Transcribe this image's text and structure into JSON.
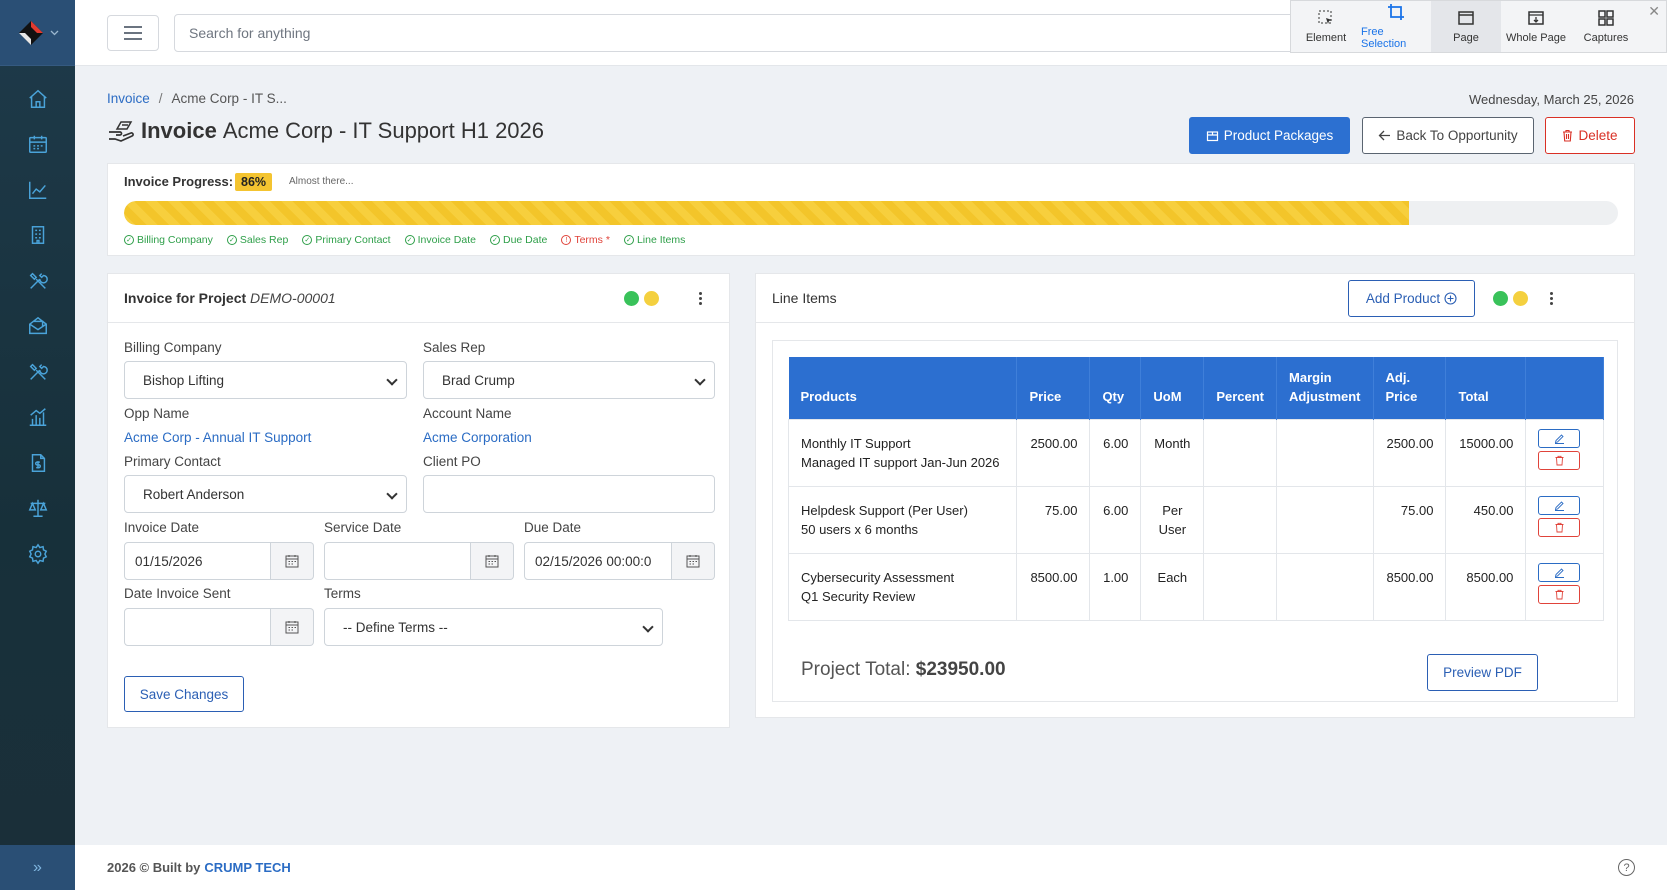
{
  "topbar": {
    "search_placeholder": "Search for anything"
  },
  "capture_toolbar": {
    "items": [
      {
        "label": "Element",
        "icon": "element-select-icon"
      },
      {
        "label": "Free Selection",
        "icon": "crop-icon"
      },
      {
        "label": "Page",
        "icon": "page-icon"
      },
      {
        "label": "Whole Page",
        "icon": "whole-page-icon"
      },
      {
        "label": "Captures",
        "icon": "grid-icon"
      }
    ],
    "active_color": "#1a73e8"
  },
  "sidebar": {
    "items": [
      {
        "icon": "home-icon"
      },
      {
        "icon": "calendar-icon"
      },
      {
        "icon": "chart-line-icon"
      },
      {
        "icon": "building-icon"
      },
      {
        "icon": "tools-icon"
      },
      {
        "icon": "mail-open-icon"
      },
      {
        "icon": "tools-icon"
      },
      {
        "icon": "bar-chart-icon"
      },
      {
        "icon": "invoice-dollar-icon"
      },
      {
        "icon": "scale-icon"
      },
      {
        "icon": "gear-icon"
      }
    ],
    "toggle": "»"
  },
  "breadcrumb": {
    "root": "Invoice",
    "current": "Acme Corp - IT S..."
  },
  "today": "Wednesday, March 25, 2026",
  "page": {
    "title_prefix": "Invoice",
    "title": "Acme Corp - IT Support H1 2026"
  },
  "header_buttons": {
    "packages": "Product Packages",
    "back": "Back To Opportunity",
    "delete": "Delete"
  },
  "progress": {
    "label": "Invoice Progress:",
    "percent_text": "86%",
    "percent": 86,
    "hint": "Almost there...",
    "checks": [
      {
        "label": "Billing Company",
        "done": true
      },
      {
        "label": "Sales Rep",
        "done": true
      },
      {
        "label": "Primary Contact",
        "done": true
      },
      {
        "label": "Invoice Date",
        "done": true
      },
      {
        "label": "Due Date",
        "done": true
      },
      {
        "label": "Terms *",
        "done": false
      },
      {
        "label": "Line Items",
        "done": true
      }
    ]
  },
  "project_card": {
    "title": "Invoice for Project",
    "project_code": "DEMO-00001",
    "fields": {
      "billing_company_label": "Billing Company",
      "billing_company": "Bishop Lifting",
      "sales_rep_label": "Sales Rep",
      "sales_rep": "Brad Crump",
      "opp_name_label": "Opp Name",
      "opp_name": "Acme Corp - Annual IT Support",
      "account_name_label": "Account Name",
      "account_name": "Acme Corporation",
      "primary_contact_label": "Primary Contact",
      "primary_contact": "Robert Anderson",
      "client_po_label": "Client PO",
      "client_po": "",
      "invoice_date_label": "Invoice Date",
      "invoice_date": "01/15/2026",
      "service_date_label": "Service Date",
      "service_date": "",
      "due_date_label": "Due Date",
      "due_date": "02/15/2026 00:00:0",
      "date_sent_label": "Date Invoice Sent",
      "date_sent": "",
      "terms_label": "Terms",
      "terms": "-- Define Terms --"
    },
    "save_button": "Save Changes"
  },
  "line_items": {
    "title": "Line Items",
    "add_button": "Add Product",
    "columns": [
      "Products",
      "Price",
      "Qty",
      "UoM",
      "Percent",
      "Margin Adjustment",
      "Adj. Price",
      "Total",
      ""
    ],
    "rows": [
      {
        "product": "Monthly IT Support",
        "desc": "Managed IT support Jan-Jun 2026",
        "price": "2500.00",
        "qty": "6.00",
        "uom": "Month",
        "percent": "",
        "margin": "",
        "adj_price": "2500.00",
        "total": "15000.00"
      },
      {
        "product": "Helpdesk Support (Per User)",
        "desc": "50 users x 6 months",
        "price": "75.00",
        "qty": "6.00",
        "uom": "Per User",
        "percent": "",
        "margin": "",
        "adj_price": "75.00",
        "total": "450.00"
      },
      {
        "product": "Cybersecurity Assessment",
        "desc": "Q1 Security Review",
        "price": "8500.00",
        "qty": "1.00",
        "uom": "Each",
        "percent": "",
        "margin": "",
        "adj_price": "8500.00",
        "total": "8500.00"
      }
    ],
    "project_total_label": "Project Total:",
    "project_total": "$23950.00",
    "preview_button": "Preview PDF"
  },
  "footer": {
    "copyright": "2026 ©  Built by",
    "brand": "CRUMP TECH",
    "help": "?"
  },
  "colors": {
    "primary": "#2c6fd0",
    "danger": "#d93025",
    "success": "#2e9f49",
    "progress": "#f4c430",
    "sidebar": "#1e3a4a"
  }
}
